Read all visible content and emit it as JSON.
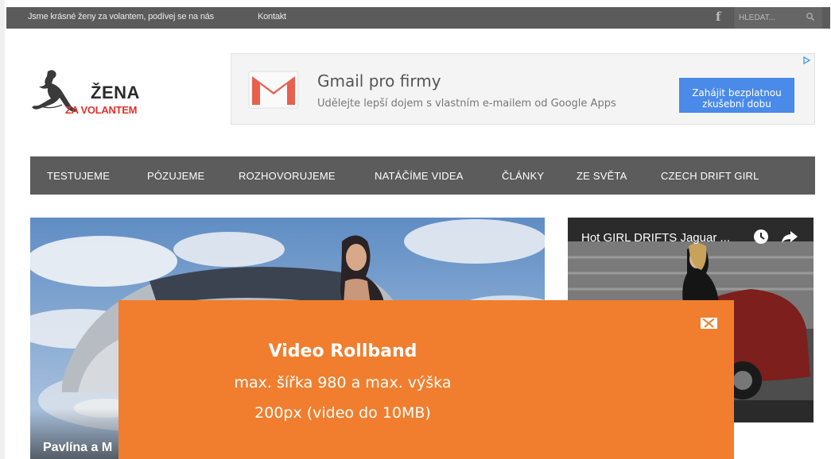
{
  "topbar": {
    "links": [
      "Jsme krásné ženy za volantem, podívej se na nás",
      "Kontakt"
    ],
    "facebook_icon": "f",
    "search_placeholder": "HLEDAT..."
  },
  "logo": {
    "line1": "ŽENA",
    "line2": "ZA VOLANTEM"
  },
  "ad": {
    "title": "Gmail pro firmy",
    "subtitle": "Udělejte lepší dojem s vlastním e-mailem od Google Apps",
    "cta": "Zahájit bezplatnou zkušební dobu",
    "icon": "gmail-logo",
    "cta_color": "#4a8ae8"
  },
  "nav": {
    "items": [
      "TESTUJEME",
      "PÓZUJEME",
      "ROZHOVORUJEME",
      "NATÁČÍME VIDEA",
      "ČLÁNKY",
      "ZE SVĚTA",
      "CZECH DRIFT GIRL"
    ]
  },
  "hero": {
    "caption": "Pavlína a M"
  },
  "video": {
    "title": "Hot GIRL DRIFTS Jaguar ..."
  },
  "overlay": {
    "heading": "Video Rollband",
    "line1": "max. šířka 980 a max. výška",
    "line2": "200px (video do 10MB)",
    "color": "#f07e2e"
  }
}
